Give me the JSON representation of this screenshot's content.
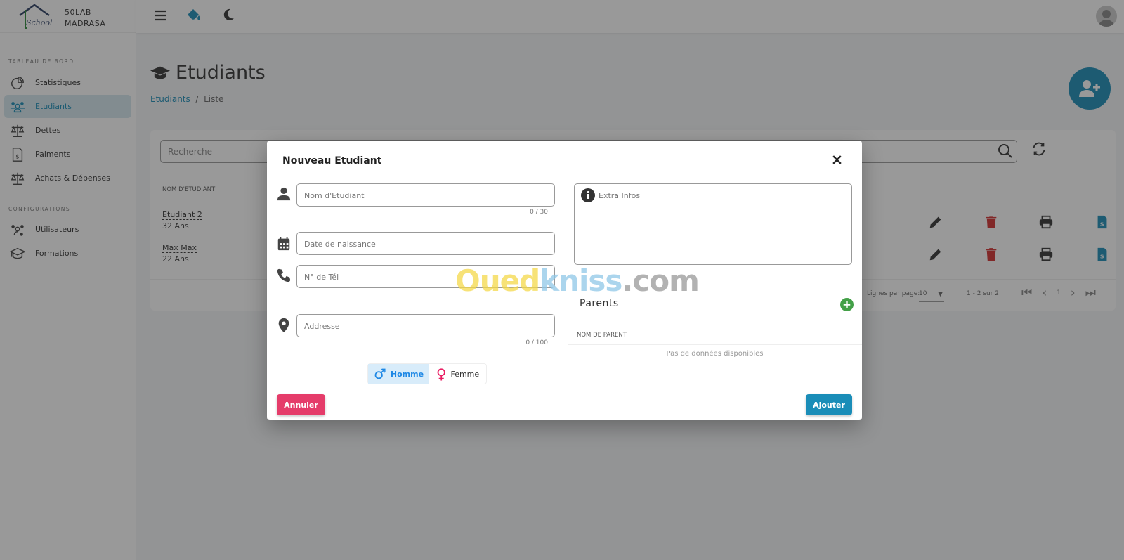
{
  "brand": {
    "line1": "50LAB",
    "line2": "MADRASA",
    "logo_text": "School"
  },
  "sidebar": {
    "section1": "TABLEAU DE BORD",
    "items1": [
      {
        "label": "Statistiques",
        "icon": "chart-pie-icon"
      },
      {
        "label": "Etudiants",
        "icon": "users-icon",
        "active": true
      },
      {
        "label": "Dettes",
        "icon": "scale-icon"
      },
      {
        "label": "Paiments",
        "icon": "invoice-icon"
      },
      {
        "label": "Achats & Dépenses",
        "icon": "scale-icon"
      }
    ],
    "section2": "CONFIGURATIONS",
    "items2": [
      {
        "label": "Utilisateurs",
        "icon": "users-cog-icon"
      },
      {
        "label": "Formations",
        "icon": "graduation-cap-icon"
      }
    ]
  },
  "page": {
    "title": "Etudiants",
    "breadcrumb": [
      "Etudiants",
      "Liste"
    ]
  },
  "table": {
    "search_placeholder": "Recherche",
    "column": "NOM D'ETUDIANT",
    "rows": [
      {
        "name": "Etudiant 2",
        "age": "32 Ans"
      },
      {
        "name": "Max Max",
        "age": "22 Ans"
      }
    ],
    "rows_per_page_label": "Lignes par page:",
    "rows_per_page": "10",
    "range": "1 - 2 sur 2",
    "page": "1"
  },
  "modal": {
    "title": "Nouveau Etudiant",
    "name_placeholder": "Nom d'Etudiant",
    "name_count": "0 / 30",
    "dob_placeholder": "Date de naissance",
    "tel_placeholder": "N° de Tél",
    "address_placeholder": "Addresse",
    "address_count": "0 / 100",
    "gender": {
      "male": "Homme",
      "female": "Femme",
      "selected": "Homme"
    },
    "extra_placeholder": "Extra Infos",
    "parents_title": "Parents",
    "parents_column": "NOM DE PARENT",
    "parents_empty": "Pas de données disponibles",
    "cancel": "Annuler",
    "submit": "Ajouter"
  },
  "watermark": {
    "part1": "Oued",
    "part2": "kniss",
    "part3": ".com"
  },
  "colors": {
    "primary": "#1a8db8",
    "danger": "#e53c6a",
    "success": "#43a047",
    "delete": "#d32f2f"
  }
}
